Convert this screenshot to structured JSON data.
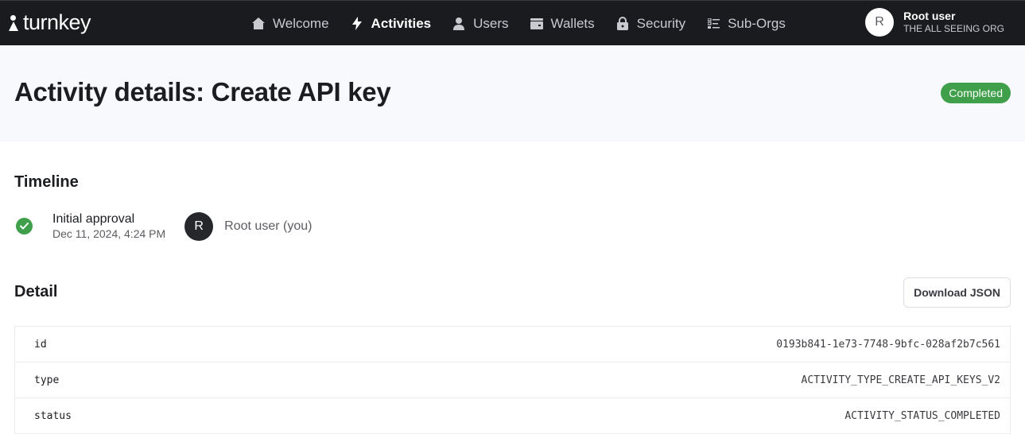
{
  "brand": {
    "name": "turnkey"
  },
  "nav": {
    "items": [
      {
        "label": "Welcome",
        "icon": "home-icon",
        "active": false
      },
      {
        "label": "Activities",
        "icon": "bolt-icon",
        "active": true
      },
      {
        "label": "Users",
        "icon": "user-icon",
        "active": false
      },
      {
        "label": "Wallets",
        "icon": "wallet-icon",
        "active": false
      },
      {
        "label": "Security",
        "icon": "lock-icon",
        "active": false
      },
      {
        "label": "Sub-Orgs",
        "icon": "list-icon",
        "active": false
      }
    ]
  },
  "user": {
    "initial": "R",
    "name": "Root user",
    "org": "THE ALL SEEING ORG"
  },
  "header": {
    "title": "Activity details: Create API key",
    "status": "Completed"
  },
  "colors": {
    "success": "#3f9f4a",
    "topbar": "#1a1b1f"
  },
  "timeline": {
    "title": "Timeline",
    "entries": [
      {
        "label": "Initial approval",
        "date": "Dec 11, 2024, 4:24 PM",
        "user_initial": "R",
        "user": "Root user (you)"
      }
    ]
  },
  "detail": {
    "title": "Detail",
    "download_label": "Download JSON",
    "rows": [
      {
        "key": "id",
        "value": "0193b841-1e73-7748-9bfc-028af2b7c561"
      },
      {
        "key": "type",
        "value": "ACTIVITY_TYPE_CREATE_API_KEYS_V2"
      },
      {
        "key": "status",
        "value": "ACTIVITY_STATUS_COMPLETED"
      }
    ]
  }
}
